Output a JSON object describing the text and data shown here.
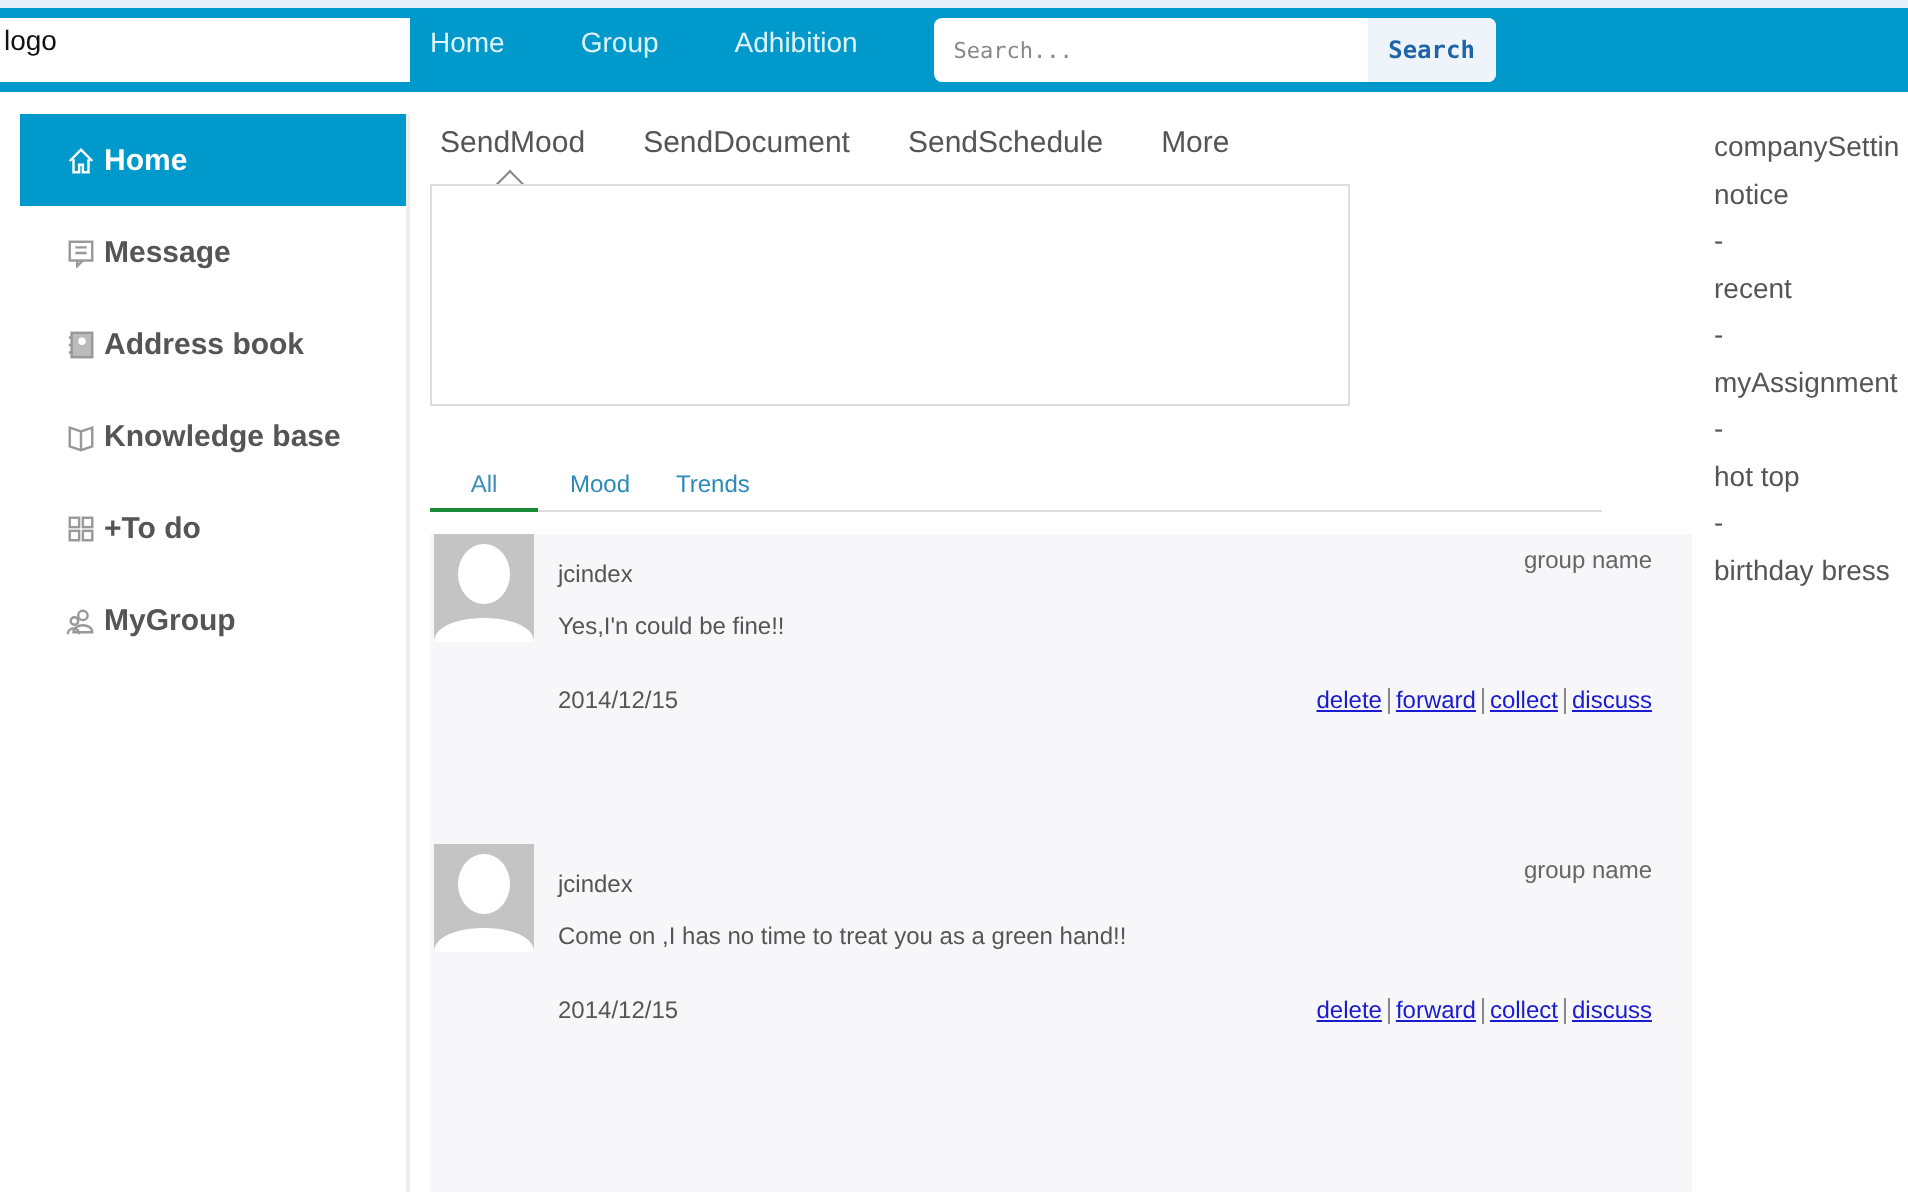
{
  "header": {
    "logo": "logo",
    "nav": [
      {
        "label": "Home"
      },
      {
        "label": "Group"
      },
      {
        "label": "Adhibition"
      }
    ],
    "search": {
      "placeholder": "Search...",
      "button": "Search"
    }
  },
  "sidebar": {
    "items": [
      {
        "label": "Home",
        "selected": true
      },
      {
        "label": "Message",
        "selected": false
      },
      {
        "label": "Address book",
        "selected": false
      },
      {
        "label": "Knowledge base",
        "selected": false
      },
      {
        "label": "+To do",
        "selected": false
      },
      {
        "label": "MyGroup",
        "selected": false
      }
    ]
  },
  "send_tabs": [
    {
      "label": "SendMood",
      "selected": true
    },
    {
      "label": "SendDocument",
      "selected": false
    },
    {
      "label": "SendSchedule",
      "selected": false
    },
    {
      "label": "More",
      "selected": false
    }
  ],
  "filter_tabs": [
    {
      "label": "All",
      "selected": true
    },
    {
      "label": "Mood",
      "selected": false
    },
    {
      "label": "Trends",
      "selected": false
    }
  ],
  "posts": [
    {
      "author": "jcindex",
      "group": "group name",
      "text": "Yes,I'n could be fine!!",
      "date": "2014/12/15",
      "actions": [
        "delete",
        "forward",
        "collect",
        "discuss"
      ]
    },
    {
      "author": "jcindex",
      "group": "group name",
      "text": "Come on ,I has no time to treat you as a green hand!!",
      "date": "2014/12/15",
      "actions": [
        "delete",
        "forward",
        "collect",
        "discuss"
      ]
    }
  ],
  "right_panel": [
    "companySettin",
    "notice",
    "-",
    "recent",
    "-",
    "myAssignment",
    "-",
    "hot top",
    "-",
    "birthday bress"
  ]
}
